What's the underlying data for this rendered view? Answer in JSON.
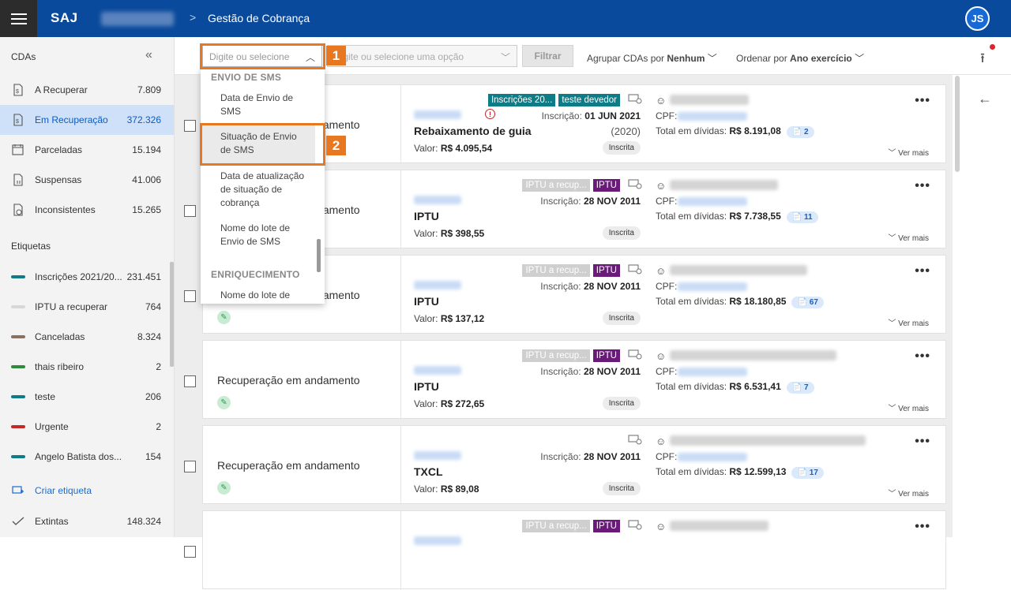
{
  "header": {
    "logo": "SAJ",
    "breadcrumb_sep": ">",
    "title": "Gestão de Cobrança",
    "avatar": "JS"
  },
  "sidebar": {
    "heading": "CDAs",
    "collapse": "«",
    "items": [
      {
        "label": "A Recuperar",
        "count": "7.809",
        "icon": "document-dollar-icon"
      },
      {
        "label": "Em Recuperação",
        "count": "372.326",
        "icon": "document-dollar-icon"
      },
      {
        "label": "Parceladas",
        "count": "15.194",
        "icon": "calendar-document-icon"
      },
      {
        "label": "Suspensas",
        "count": "41.006",
        "icon": "document-pause-icon"
      },
      {
        "label": "Inconsistentes",
        "count": "15.265",
        "icon": "document-clock-icon"
      }
    ],
    "labels_heading": "Etiquetas",
    "labels": [
      {
        "label": "Inscrições 2021/20...",
        "count": "231.451",
        "color": "#0e7c86"
      },
      {
        "label": "IPTU a recuperar",
        "count": "764",
        "color": "#d7d7d7"
      },
      {
        "label": "Canceladas",
        "count": "8.324",
        "color": "#8d6e63"
      },
      {
        "label": "thais ribeiro",
        "count": "2",
        "color": "#2e8b3a"
      },
      {
        "label": "teste",
        "count": "206",
        "color": "#0e7c86"
      },
      {
        "label": "Urgente",
        "count": "2",
        "color": "#c62828"
      },
      {
        "label": "Angelo Batista dos...",
        "count": "154",
        "color": "#0e7c86"
      }
    ],
    "create_label": "Criar etiqueta",
    "extintas": {
      "label": "Extintas",
      "count": "148.324"
    }
  },
  "toolbar": {
    "select1_placeholder": "Digite ou selecione",
    "select2_placeholder": "Digite ou selecione uma opção",
    "filter": "Filtrar",
    "group_prefix": "Agrupar CDAs por",
    "group_value": "Nenhum",
    "order_prefix": "Ordenar por",
    "order_value": "Ano exercício"
  },
  "dropdown": {
    "group1": "ENVIO DE SMS",
    "items1": [
      "Data de Envio de SMS",
      "Situação de Envio de SMS",
      "Data de atualização de situação de cobrança",
      "Nome do lote de Envio de SMS"
    ],
    "group2": "ENRIQUECIMENTO",
    "items2": [
      "Nome do lote de"
    ]
  },
  "callouts": [
    "1",
    "2"
  ],
  "cards": [
    {
      "status": "Recuperação em andamento",
      "badges": [
        {
          "text": "Inscrições 20...",
          "bg": "#0e7c86"
        },
        {
          "text": "teste devedor",
          "bg": "#0e7c86"
        }
      ],
      "insc_label": "Inscrição:",
      "insc_date": "01 JUN 2021",
      "title": "Rebaixamento de guia",
      "year": "(2020)",
      "valor_label": "Valor:",
      "valor": "R$ 4.095,54",
      "chip": "Inscrita",
      "cpf": "CPF:",
      "total_label": "Total em dívidas:",
      "total": "R$ 8.191,08",
      "docs": "2",
      "ver": "Ver mais",
      "alert": "!"
    },
    {
      "status": "Recuperação em andamento",
      "badges": [
        {
          "text": "IPTU a recup...",
          "bg": "#cfcfcf"
        },
        {
          "text": "IPTU",
          "bg": "#6a1b7a"
        }
      ],
      "insc_label": "Inscrição:",
      "insc_date": "28 NOV 2011",
      "title": "IPTU",
      "year": "",
      "valor_label": "Valor:",
      "valor": "R$ 398,55",
      "chip": "Inscrita",
      "cpf": "CPF:",
      "total_label": "Total em dívidas:",
      "total": "R$ 7.738,55",
      "docs": "11",
      "ver": "Ver mais"
    },
    {
      "status": "Recuperação em andamento",
      "badges": [
        {
          "text": "IPTU a recup...",
          "bg": "#cfcfcf"
        },
        {
          "text": "IPTU",
          "bg": "#6a1b7a"
        }
      ],
      "insc_label": "Inscrição:",
      "insc_date": "28 NOV 2011",
      "title": "IPTU",
      "year": "",
      "valor_label": "Valor:",
      "valor": "R$ 137,12",
      "chip": "Inscrita",
      "cpf": "CPF:",
      "total_label": "Total em dívidas:",
      "total": "R$ 18.180,85",
      "docs": "67",
      "ver": "Ver mais"
    },
    {
      "status": "Recuperação em andamento",
      "badges": [
        {
          "text": "IPTU a recup...",
          "bg": "#cfcfcf"
        },
        {
          "text": "IPTU",
          "bg": "#6a1b7a"
        }
      ],
      "insc_label": "Inscrição:",
      "insc_date": "28 NOV 2011",
      "title": "IPTU",
      "year": "",
      "valor_label": "Valor:",
      "valor": "R$ 272,65",
      "chip": "Inscrita",
      "cpf": "CPF:",
      "total_label": "Total em dívidas:",
      "total": "R$ 6.531,41",
      "docs": "7",
      "ver": "Ver mais"
    },
    {
      "status": "Recuperação em andamento",
      "badges": [],
      "insc_label": "Inscrição:",
      "insc_date": "28 NOV 2011",
      "title": "TXCL",
      "year": "",
      "valor_label": "Valor:",
      "valor": "R$ 89,08",
      "chip": "Inscrita",
      "cpf": "CPF:",
      "total_label": "Total em dívidas:",
      "total": "R$ 12.599,13",
      "docs": "17",
      "ver": "Ver mais"
    },
    {
      "status": "",
      "badges": [
        {
          "text": "IPTU a recup...",
          "bg": "#cfcfcf"
        },
        {
          "text": "IPTU",
          "bg": "#6a1b7a"
        }
      ],
      "insc_label": "",
      "insc_date": "",
      "title": "",
      "year": "",
      "valor_label": "",
      "valor": "",
      "chip": "",
      "cpf": "",
      "total_label": "",
      "total": "",
      "docs": "",
      "ver": ""
    }
  ]
}
